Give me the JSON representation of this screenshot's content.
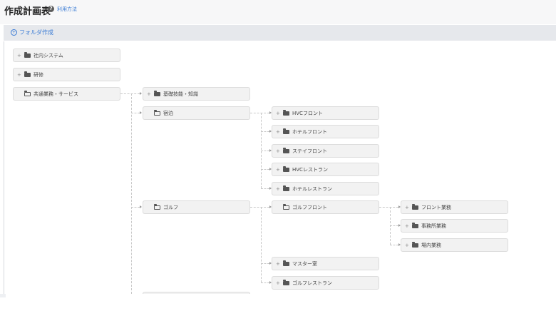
{
  "header": {
    "title": "作成計画表",
    "help_label": "利用方法"
  },
  "toolbar": {
    "folder_create_label": "フォルダ作成"
  },
  "tree": {
    "expand_symbol": "+",
    "roots": [
      {
        "label": "社内システム",
        "state": "collapsed"
      },
      {
        "label": "研修",
        "state": "collapsed"
      },
      {
        "label": "共通業務・サービス",
        "state": "expanded"
      }
    ],
    "common_children": [
      {
        "label": "基礎技能・知識",
        "state": "collapsed"
      },
      {
        "label": "宿泊",
        "state": "expanded"
      },
      {
        "label": "ゴルフ",
        "state": "expanded"
      }
    ],
    "lodging_children": [
      {
        "label": "HVCフロント",
        "state": "collapsed"
      },
      {
        "label": "ホテルフロント",
        "state": "collapsed"
      },
      {
        "label": "ステイフロント",
        "state": "collapsed"
      },
      {
        "label": "HVCレストラン",
        "state": "collapsed"
      },
      {
        "label": "ホテルレストラン",
        "state": "collapsed"
      }
    ],
    "golf_children": [
      {
        "label": "ゴルフフロント",
        "state": "expanded"
      },
      {
        "label": "マスター室",
        "state": "collapsed"
      },
      {
        "label": "ゴルフレストラン",
        "state": "collapsed"
      }
    ],
    "golf_front_children": [
      {
        "label": "フロント業務",
        "state": "collapsed"
      },
      {
        "label": "事務所業務",
        "state": "collapsed"
      },
      {
        "label": "場内業務",
        "state": "collapsed"
      }
    ]
  }
}
